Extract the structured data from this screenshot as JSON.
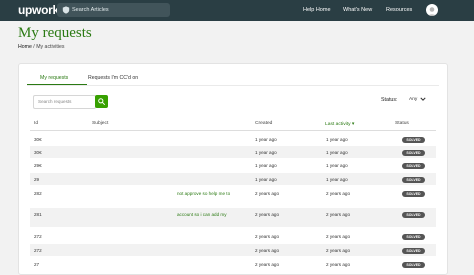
{
  "header": {
    "logo": "upwork",
    "search_placeholder": "Search Articles",
    "nav": [
      "Help Home",
      "What's New",
      "Resources"
    ]
  },
  "page": {
    "title": "My requests",
    "breadcrumb": {
      "home": "Home",
      "separator": "/",
      "current": "My activities"
    }
  },
  "tabs": {
    "active": "My requests",
    "other": "Requests I'm CC'd on"
  },
  "filters": {
    "search_placeholder": "Search requests",
    "status_label": "Status:",
    "status_value": "Any"
  },
  "table": {
    "columns": [
      "Id",
      "Subject",
      "Created",
      "Last activity ▾",
      "Status"
    ],
    "rows": [
      {
        "id": "30€",
        "subject": "",
        "created": "1 year ago",
        "last": "1 year ago",
        "status": "SOLVED"
      },
      {
        "id": "30€",
        "subject": "",
        "created": "1 year ago",
        "last": "1 year ago",
        "status": "SOLVED"
      },
      {
        "id": "29€",
        "subject": "",
        "created": "1 year ago",
        "last": "1 year ago",
        "status": "SOLVED"
      },
      {
        "id": "29",
        "subject": "",
        "created": "1 year ago",
        "last": "1 year ago",
        "status": "SOLVED"
      },
      {
        "id": "282",
        "subject": "not approve so help me to",
        "created": "2 years ago",
        "last": "2 years ago",
        "status": "SOLVED"
      },
      {
        "id": "281",
        "subject": "account so i can add my",
        "created": "2 years ago",
        "last": "2 years ago",
        "status": "SOLVED"
      },
      {
        "id": "272",
        "subject": "",
        "created": "2 years ago",
        "last": "2 years ago",
        "status": "SOLVED"
      },
      {
        "id": "272",
        "subject": "",
        "created": "2 years ago",
        "last": "2 years ago",
        "status": "SOLVED"
      },
      {
        "id": "27",
        "subject": "",
        "created": "2 years ago",
        "last": "2 years ago",
        "status": "SOLVED"
      }
    ]
  },
  "colors": {
    "brand_green": "#37a000",
    "header_bg": "#2a3e44",
    "title_green": "#2b7a13"
  }
}
